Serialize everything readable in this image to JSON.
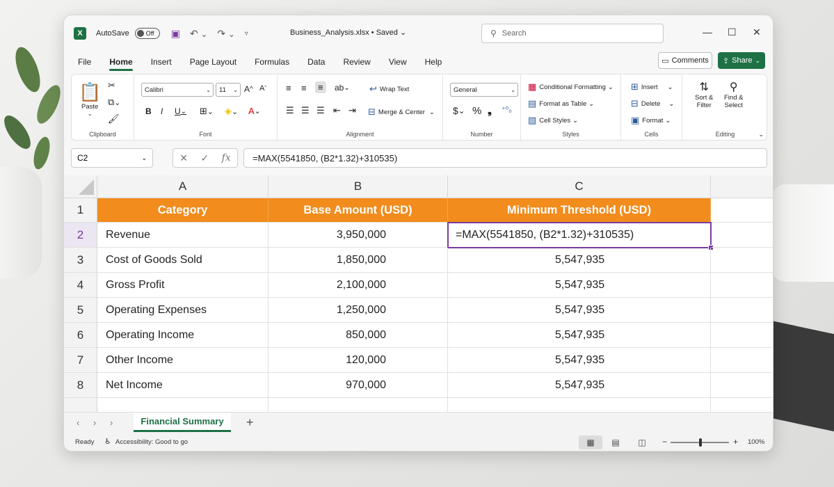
{
  "titlebar": {
    "autosave_label": "AutoSave",
    "autosave_state": "Off",
    "filename": "Business_Analysis.xlsx",
    "saved_status": "• Saved",
    "search_placeholder": "Search"
  },
  "menu": {
    "tabs": [
      "File",
      "Home",
      "Insert",
      "Page Layout",
      "Formulas",
      "Data",
      "Review",
      "View",
      "Help"
    ],
    "active": "Home",
    "comments_label": "Comments",
    "share_label": "Share"
  },
  "ribbon": {
    "clipboard": {
      "paste": "Paste",
      "label": "Clipboard"
    },
    "font": {
      "name": "Calibri",
      "size": "11",
      "label": "Font"
    },
    "alignment": {
      "wrap_text": "Wrap Text",
      "merge_center": "Merge & Center",
      "label": "Alignment"
    },
    "number": {
      "format": "General",
      "label": "Number"
    },
    "styles": {
      "conditional": "Conditional Formatting",
      "format_table": "Format as Table",
      "cell_styles": "Cell Styles",
      "label": "Styles"
    },
    "cells": {
      "insert": "Insert",
      "delete": "Delete",
      "format": "Format",
      "label": "Cells"
    },
    "editing": {
      "sort_filter_1": "Sort &",
      "sort_filter_2": "Filter",
      "find_select_1": "Find &",
      "find_select_2": "Select",
      "label": "Editing"
    }
  },
  "formula_bar": {
    "name_box": "C2",
    "formula": "=MAX(5541850, (B2*1.32)+310535)"
  },
  "sheet": {
    "columns": [
      "A",
      "B",
      "C"
    ],
    "rows": [
      "1",
      "2",
      "3",
      "4",
      "5",
      "6",
      "7",
      "8"
    ],
    "headers": [
      "Category",
      "Base Amount (USD)",
      "Minimum Threshold (USD)"
    ],
    "data": [
      [
        "Revenue",
        "3,950,000",
        "=MAX(5541850, (B2*1.32)+310535)"
      ],
      [
        "Cost of Goods Sold",
        "1,850,000",
        "5,547,935"
      ],
      [
        "Gross Profit",
        "2,100,000",
        "5,547,935"
      ],
      [
        "Operating Expenses",
        "1,250,000",
        "5,547,935"
      ],
      [
        "Operating Income",
        "850,000",
        "5,547,935"
      ],
      [
        "Other Income",
        "120,000",
        "5,547,935"
      ],
      [
        "Net Income",
        "970,000",
        "5,547,935"
      ]
    ],
    "header_color": "#f28c1c",
    "active_color": "#7a3b9f"
  },
  "sheet_tabs": {
    "active": "Financial Summary"
  },
  "status": {
    "ready": "Ready",
    "accessibility": "Accessibility: Good to go",
    "zoom": "100%"
  }
}
